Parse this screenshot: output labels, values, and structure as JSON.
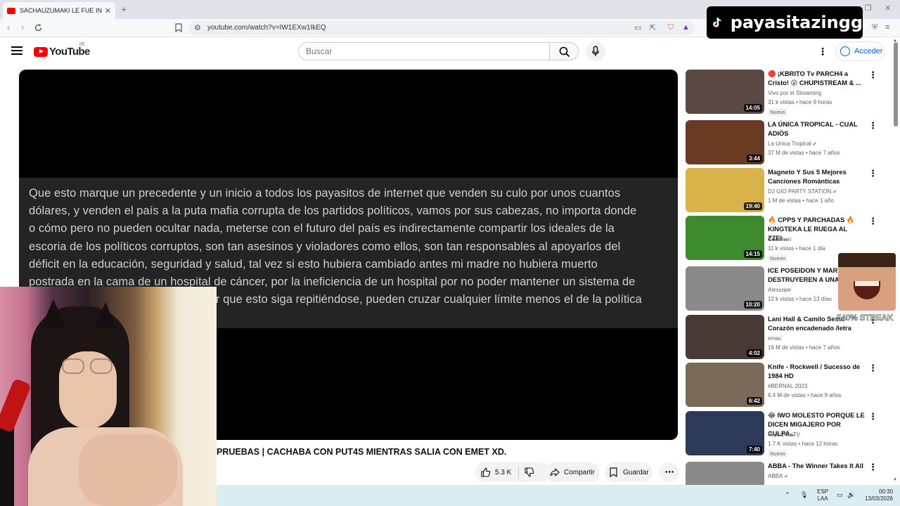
{
  "browser": {
    "tab_title": "SACHAUZUMAKI LE FUE INFIEL",
    "url": "youtube.com/watch?v=IW1EXw1IkEQ"
  },
  "overlay": {
    "tiktok_handle": "payasitazingg",
    "streak_text": "540% STREAK"
  },
  "youtube": {
    "logo_text": "YouTube",
    "country_code": "PE",
    "search_placeholder": "Buscar",
    "signin_label": "Acceder"
  },
  "player": {
    "caption_lines": [
      "Que esto marque un precedente y un inicio a todos los payasitos de internet que venden su culo por unos cuantos",
      "dólares, y venden el país a la puta mafia corrupta de los partidos políticos, vamos por sus cabezas, no importa donde",
      "o cómo pero no pueden ocultar nada, meterse con el futuro del país es indirectamente compartir los ideales de la",
      "escoria de los políticos corruptos, son tan asesinos y violadores como ellos, son tan responsables al apoyarlos del",
      "déficit en la educación, seguridad y salud, tal vez si esto hubiera cambiado antes mi madre no hubiera muerto",
      "postrada en la cama de un hospital de cáncer, por la ineficiencia de un hospital por no poder mantener un sistema de",
      "r que esto siga repitiéndose, pueden cruzar cualquier límite menos el de la política"
    ]
  },
  "video": {
    "title": "PRUEBAS | CACHABA CON PUT4S MIENTRAS SALIA CON EMET XD.",
    "like_count": "5.3 K",
    "share_label": "Compartir",
    "save_label": "Guardar"
  },
  "recommendations": [
    {
      "title": "🔴 ¡KBRITO Tv PARCH4 a Cristo! 😮 CHUPISTREAM & ...",
      "channel": "Vivo por el Streaming",
      "meta": "31 k vistas • hace 9 horas",
      "duration": "14:05",
      "badge": "Nuevo",
      "verified": false
    },
    {
      "title": "LA ÚNICA TROPICAL - CUAL ADIÓS",
      "channel": "La Unica Tropical",
      "meta": "37 M de vistas • hace 7 años",
      "duration": "3:44",
      "badge": "",
      "verified": true
    },
    {
      "title": "Magneto Y Sus 5 Mejores Canciones Románticas",
      "channel": "DJ GIO PARTY STATION",
      "meta": "1 M de vistas • hace 1 año",
      "duration": "19:40",
      "badge": "",
      "verified": true
    },
    {
      "title": "🔥 CPPS Y PARCHADAS 🔥 KINGTEKA LE RUEGA AL ZZEI...",
      "channel": "Cevichon",
      "meta": "11 k vistas • hace 1 día",
      "duration": "14:15",
      "badge": "Nuevo",
      "verified": false
    },
    {
      "title": "ICE POSEIDON Y MARIN DESTRUYEREN A UNA F...",
      "channel": "Alessope",
      "meta": "12 k vistas • hace 13 días",
      "duration": "10:20",
      "badge": "",
      "verified": false
    },
    {
      "title": "Lani Hall & Camilo Sesto Corazón encadenado   /letra",
      "channel": "emac",
      "meta": "16 M de vistas • hace 7 años",
      "duration": "4:02",
      "badge": "",
      "verified": false
    },
    {
      "title": "Knife - Rockwell /  Sucesso de 1984  HD",
      "channel": "#BERNAL 2023",
      "meta": "6.4 M de vistas • hace 9 años",
      "duration": "6:42",
      "badge": "",
      "verified": false
    },
    {
      "title": "😂 IWO MOLESTO PORQUE LE DICEN MIGAJERO POR CULPA...",
      "channel": "PapuDotaTV",
      "meta": "1.7 K vistas • hace 12 horas",
      "duration": "7:40",
      "badge": "Nuevo",
      "verified": false
    },
    {
      "title": "ABBA - The Winner Takes It All",
      "channel": "ABBA",
      "meta": "",
      "duration": "",
      "badge": "",
      "verified": true
    }
  ],
  "thumb_colors": [
    "#5b4a44",
    "#6b3a22",
    "#d9b24a",
    "#3e8a2e",
    "#8a8a8a",
    "#4a3a36",
    "#7a6a5a",
    "#2e3a5a",
    "#8a8a8a"
  ],
  "taskbar": {
    "lang_top": "ESP",
    "lang_bottom": "LAA",
    "time": "00:30",
    "date": "13/03/2026"
  }
}
